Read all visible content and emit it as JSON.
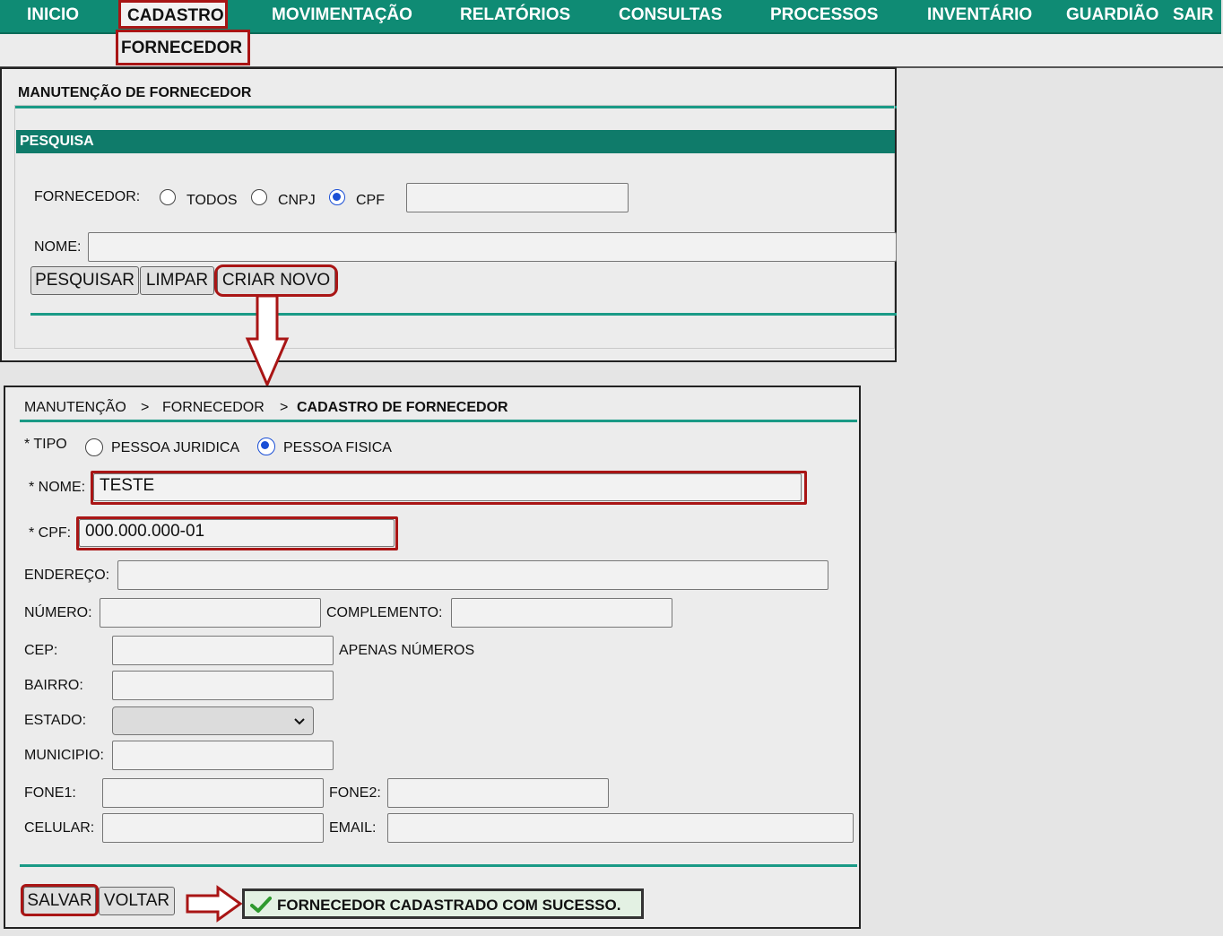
{
  "nav": {
    "items": [
      "INICIO",
      "CADASTRO",
      "MOVIMENTAÇÃO",
      "RELATÓRIOS",
      "CONSULTAS",
      "PROCESSOS",
      "INVENTÁRIO",
      "GUARDIÃO",
      "SAIR"
    ],
    "active": "CADASTRO",
    "sub_item": "FORNECEDOR"
  },
  "search_panel": {
    "title": "MANUTENÇÃO DE FORNECEDOR",
    "section": "PESQUISA",
    "fornecedor_label": "FORNECEDOR:",
    "radio_options": [
      "TODOS",
      "CNPJ",
      "CPF"
    ],
    "selected_option": "CPF",
    "document_value": "",
    "nome_label": "NOME:",
    "nome_value": "",
    "buttons": {
      "search": "PESQUISAR",
      "clear": "LIMPAR",
      "create": "CRIAR NOVO"
    }
  },
  "form_panel": {
    "breadcrumb": [
      "MANUTENÇÃO",
      "FORNECEDOR",
      "CADASTRO DE FORNECEDOR"
    ],
    "breadcrumb_sep": ">",
    "tipo_label": "* TIPO",
    "tipo_options": [
      "PESSOA JURIDICA",
      "PESSOA FISICA"
    ],
    "tipo_selected": "PESSOA FISICA",
    "labels": {
      "nome": "* NOME:",
      "cpf": "* CPF:",
      "endereco": "ENDEREÇO:",
      "numero": "NÚMERO:",
      "complemento": "COMPLEMENTO:",
      "cep": "CEP:",
      "cep_hint": "APENAS NÚMEROS",
      "bairro": "BAIRRO:",
      "estado": "ESTADO:",
      "municipio": "MUNICIPIO:",
      "fone1": "FONE1:",
      "fone2": "FONE2:",
      "celular": "CELULAR:",
      "email": "EMAIL:"
    },
    "values": {
      "nome": "TESTE",
      "cpf": "000.000.000-01",
      "endereco": "",
      "numero": "",
      "complemento": "",
      "cep": "",
      "bairro": "",
      "estado": "",
      "municipio": "",
      "fone1": "",
      "fone2": "",
      "celular": "",
      "email": ""
    },
    "buttons": {
      "save": "SALVAR",
      "back": "VOLTAR"
    },
    "success_message": "FORNECEDOR CADASTRADO COM SUCESSO."
  },
  "colors": {
    "nav_teal": "#0f8b74",
    "highlight_red": "#a91515",
    "radio_blue": "#1a4fd6"
  }
}
